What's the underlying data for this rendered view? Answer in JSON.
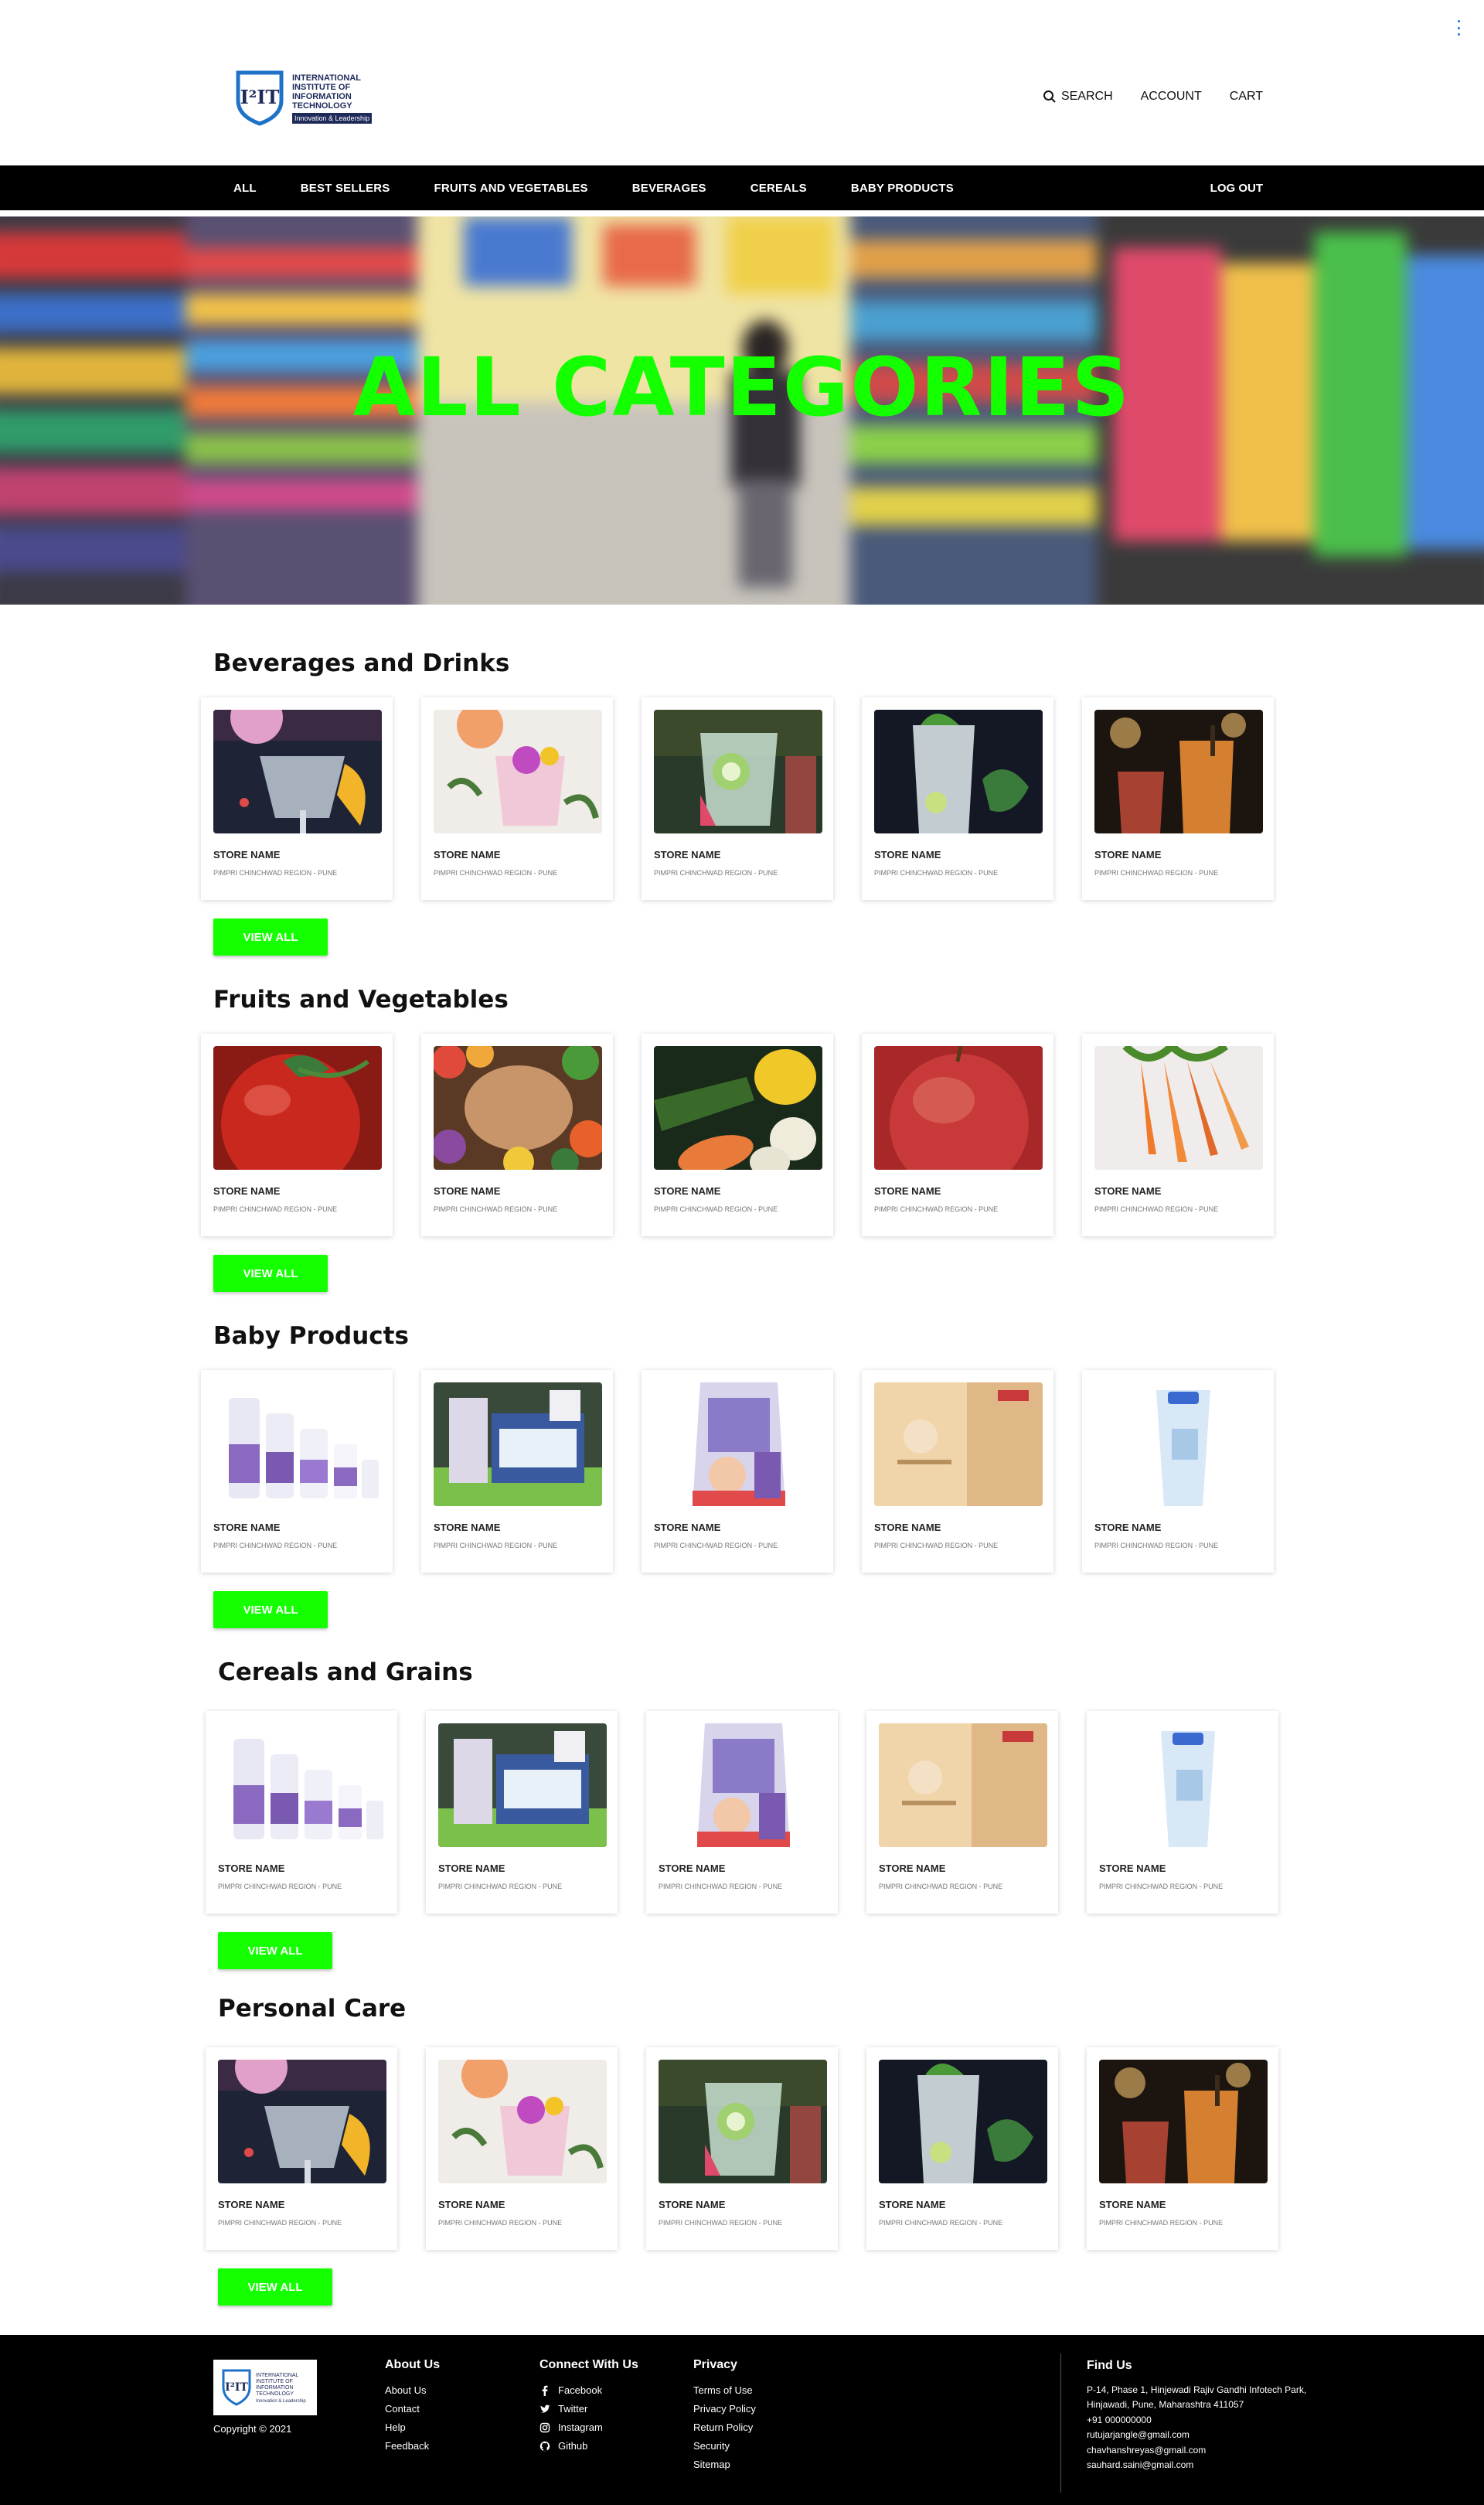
{
  "header": {
    "logo": {
      "mark": "I²IT",
      "lines": [
        "INTERNATIONAL",
        "INSTITUTE OF",
        "INFORMATION",
        "TECHNOLOGY"
      ],
      "tagline": "Innovation & Leadership"
    },
    "nav": {
      "search": "SEARCH",
      "account": "ACCOUNT",
      "cart": "CART"
    }
  },
  "category_bar": {
    "items": [
      "ALL",
      "BEST SELLERS",
      "FRUITS AND VEGETABLES",
      "BEVERAGES",
      "CEREALS",
      "BABY PRODUCTS"
    ],
    "logout": "LOG OUT"
  },
  "hero": {
    "title": "ALL CATEGORIES"
  },
  "card_text": {
    "store": "STORE NAME",
    "region": "PIMPRI CHINCHWAD REGION - PUNE"
  },
  "view_all_label": "VIEW ALL",
  "sections": [
    {
      "title": "Beverages and Drinks",
      "images": [
        "pink-cocktail",
        "floral-cocktail",
        "cucumber-drink",
        "mojito",
        "iced-tea"
      ]
    },
    {
      "title": "Fruits and Vegetables",
      "images": [
        "tomato",
        "vegetable-board",
        "peppers-and-vegetables",
        "apple",
        "carrots"
      ]
    },
    {
      "title": "Baby Products",
      "images": [
        "baby-lotion-bottles",
        "baby-product-boxes",
        "baby-gift-pack",
        "baby-cream",
        "baby-tube"
      ]
    },
    {
      "title": "Cereals and Grains",
      "images": [
        "baby-lotion-bottles",
        "baby-product-boxes",
        "baby-gift-pack",
        "baby-cream",
        "baby-tube"
      ]
    },
    {
      "title": "Personal Care",
      "images": [
        "pink-cocktail",
        "floral-cocktail",
        "cucumber-drink",
        "mojito",
        "iced-tea"
      ]
    }
  ],
  "footer": {
    "logo": {
      "mark": "I²IT",
      "lines": [
        "INTERNATIONAL",
        "INSTITUTE OF",
        "INFORMATION",
        "TECHNOLOGY"
      ],
      "tagline": "Innovation & Leadership"
    },
    "copyright": "Copyright © 2021",
    "about": {
      "heading": "About Us",
      "links": [
        "About Us",
        "Contact",
        "Help",
        "Feedback"
      ]
    },
    "connect": {
      "heading": "Connect With Us",
      "links": [
        "Facebook",
        "Twitter",
        "Instagram",
        "Github"
      ]
    },
    "privacy": {
      "heading": "Privacy",
      "links": [
        "Terms of Use",
        "Privacy Policy",
        "Return Policy",
        "Security",
        "Sitemap"
      ]
    },
    "find": {
      "heading": "Find Us",
      "lines": [
        "P-14, Phase 1, Hinjewadi Rajiv Gandhi Infotech Park,",
        "Hinjawadi, Pune, Maharashtra 411057",
        "+91 000000000",
        "rutujarjangle@gmail.com",
        "chavhanshreyas@gmail.com",
        "sauhard.saini@gmail.com"
      ]
    }
  },
  "colors": {
    "accent": "#14ff00",
    "nav_bg": "#000000",
    "footer_bg": "#000000",
    "brand_blue": "#1e2a5a"
  }
}
